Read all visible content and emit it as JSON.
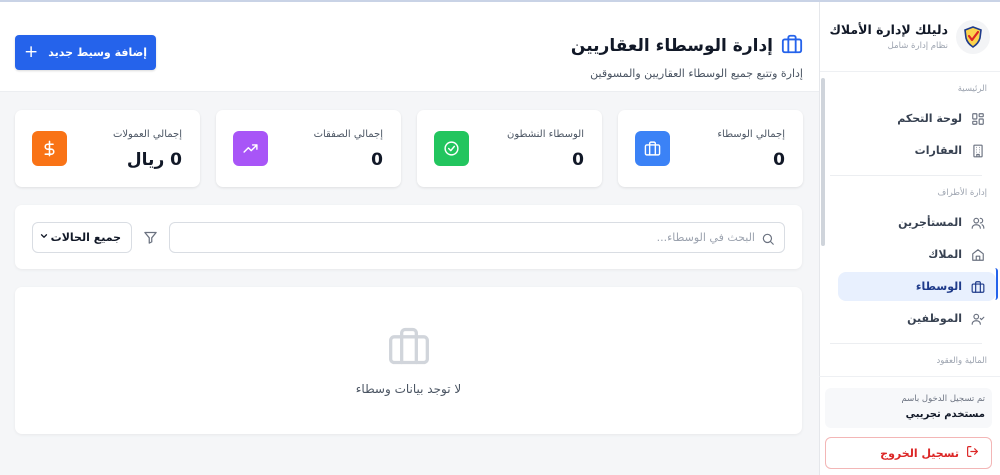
{
  "brand": {
    "title": "دليلك لإدارة الأملاك",
    "subtitle": "نظام إدارة شامل"
  },
  "sidebar": {
    "sections": [
      {
        "title": "الرئيسية",
        "items": [
          {
            "label": "لوحة التحكم",
            "icon": "dashboard-icon"
          },
          {
            "label": "العقارات",
            "icon": "building-icon"
          }
        ]
      },
      {
        "title": "إدارة الأطراف",
        "items": [
          {
            "label": "المستأجرين",
            "icon": "users-icon"
          },
          {
            "label": "الملاك",
            "icon": "home-icon"
          },
          {
            "label": "الوسطاء",
            "icon": "briefcase-icon",
            "active": true
          },
          {
            "label": "الموظفين",
            "icon": "user-check-icon"
          }
        ]
      },
      {
        "title": "المالية والعقود",
        "items": []
      }
    ],
    "user_caption": "تم تسجيل الدخول باسم",
    "user_name": "مستخدم تجريبي",
    "logout_label": "تسجيل الخروج"
  },
  "header": {
    "title": "إدارة الوسطاء العقاريين",
    "subtitle": "إدارة وتتبع جميع الوسطاء العقاريين والمسوقين",
    "add_button_label": "إضافة وسيط جديد"
  },
  "stats": [
    {
      "label": "إجمالي الوسطاء",
      "value": "0",
      "icon": "briefcase-icon",
      "color": "#3b82f6"
    },
    {
      "label": "الوسطاء النشطون",
      "value": "0",
      "icon": "check-circle-icon",
      "color": "#22c55e"
    },
    {
      "label": "إجمالي الصفقات",
      "value": "0",
      "icon": "trending-up-icon",
      "color": "#a855f7"
    },
    {
      "label": "إجمالي العمولات",
      "value": "0 ريال",
      "icon": "dollar-icon",
      "color": "#f97316"
    }
  ],
  "filters": {
    "search_placeholder": "البحث في الوسطاء...",
    "status_selected": "جميع الحالات"
  },
  "empty_state": {
    "message": "لا توجد بيانات وسطاء"
  },
  "colors": {
    "primary": "#2563eb",
    "active_nav_bg": "#e8f0fe",
    "danger": "#dc2626"
  }
}
